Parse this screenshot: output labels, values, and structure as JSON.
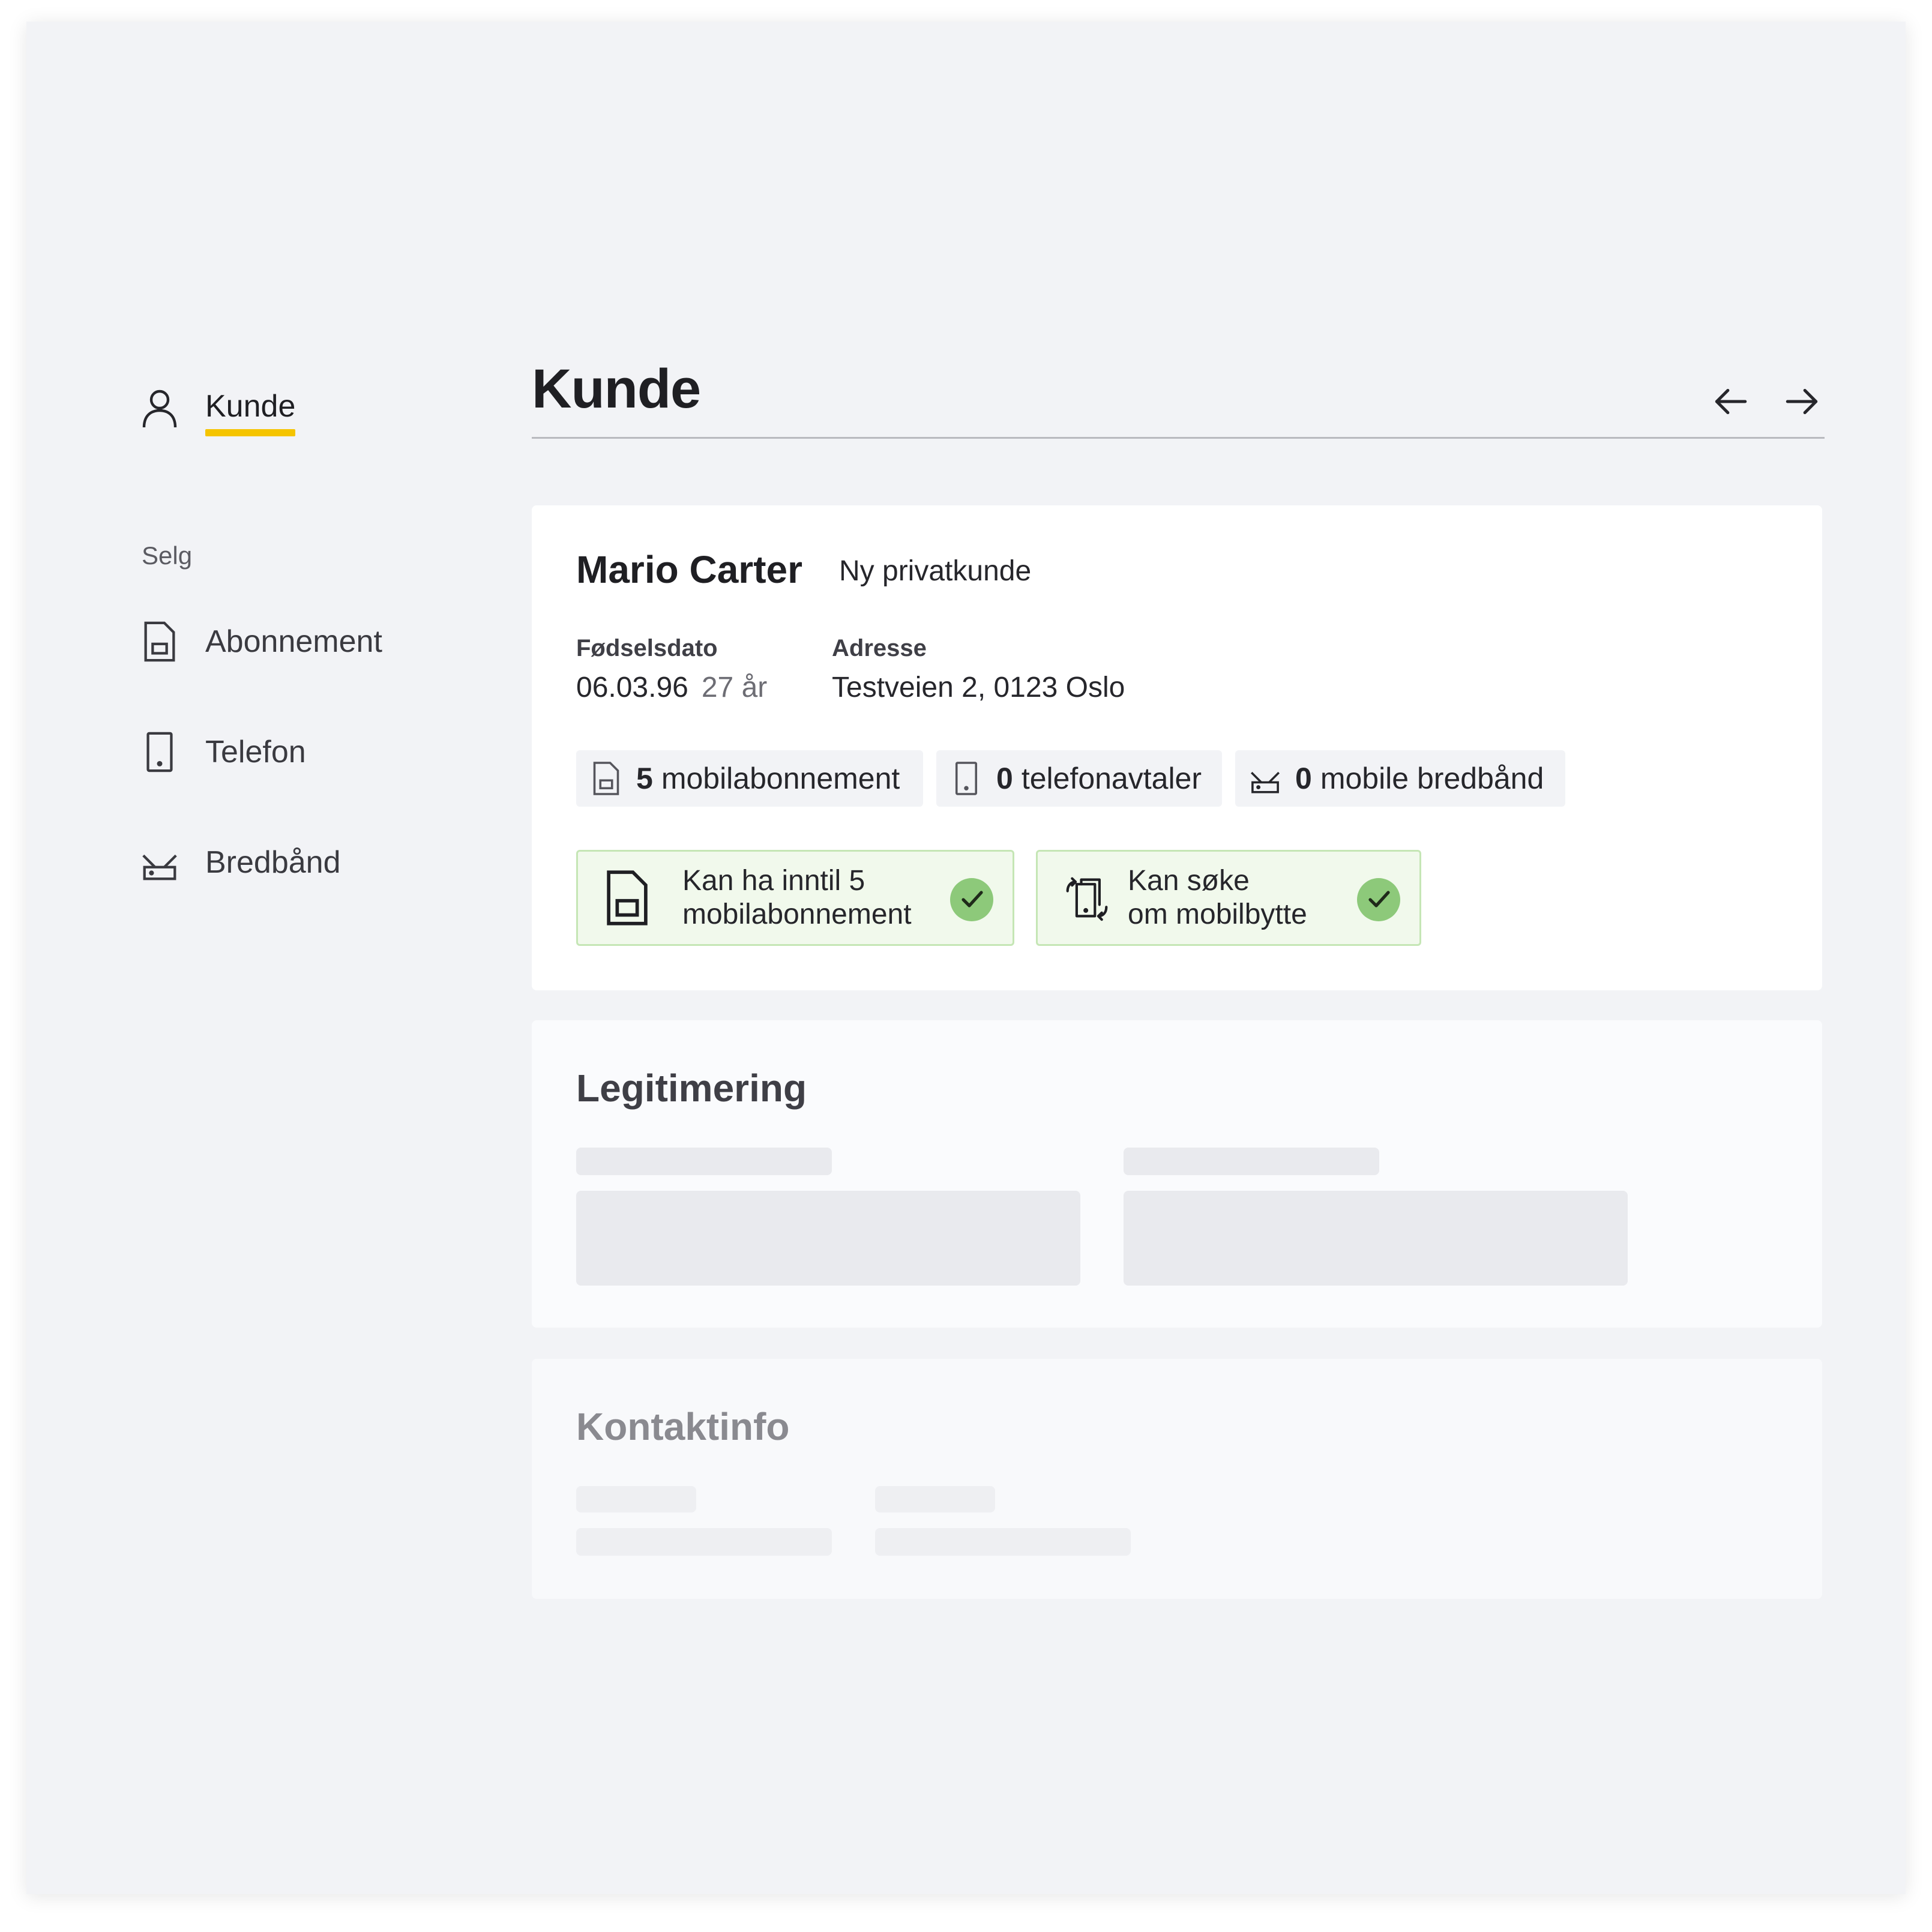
{
  "sidebar": {
    "active_label": "Kunde",
    "section_label": "Selg",
    "items": [
      {
        "label": "Abonnement",
        "icon": "sim-card-icon"
      },
      {
        "label": "Telefon",
        "icon": "phone-icon"
      },
      {
        "label": "Bredbånd",
        "icon": "router-icon"
      }
    ]
  },
  "header": {
    "title": "Kunde",
    "prev_icon": "arrow-left-icon",
    "next_icon": "arrow-right-icon"
  },
  "customer": {
    "name": "Mario Carter",
    "type": "Ny privatkunde",
    "birth_label": "Fødselsdato",
    "birth_value": "06.03.96",
    "age": "27 år",
    "address_label": "Adresse",
    "address_value": "Testveien 2, 0123 Oslo",
    "chips": [
      {
        "count": "5",
        "label": "mobilabonnement",
        "icon": "sim-card-icon"
      },
      {
        "count": "0",
        "label": "telefonavtaler",
        "icon": "phone-icon"
      },
      {
        "count": "0",
        "label": "mobile bredbånd",
        "icon": "router-icon"
      }
    ],
    "eligibility": [
      {
        "line1": "Kan ha inntil 5",
        "line2": "mobilabonnement",
        "icon": "sim-card-icon",
        "status": "check-icon"
      },
      {
        "line1": "Kan søke",
        "line2": "om mobilbytte",
        "icon": "phone-swap-icon",
        "status": "check-icon"
      }
    ]
  },
  "legitimering": {
    "title": "Legitimering"
  },
  "kontaktinfo": {
    "title": "Kontaktinfo"
  },
  "colors": {
    "accent_yellow": "#f5c400",
    "ok_bg": "#f1f9ec",
    "ok_border": "#c5e6b5",
    "check_green": "#8dc97a",
    "background": "#f2f3f6"
  }
}
